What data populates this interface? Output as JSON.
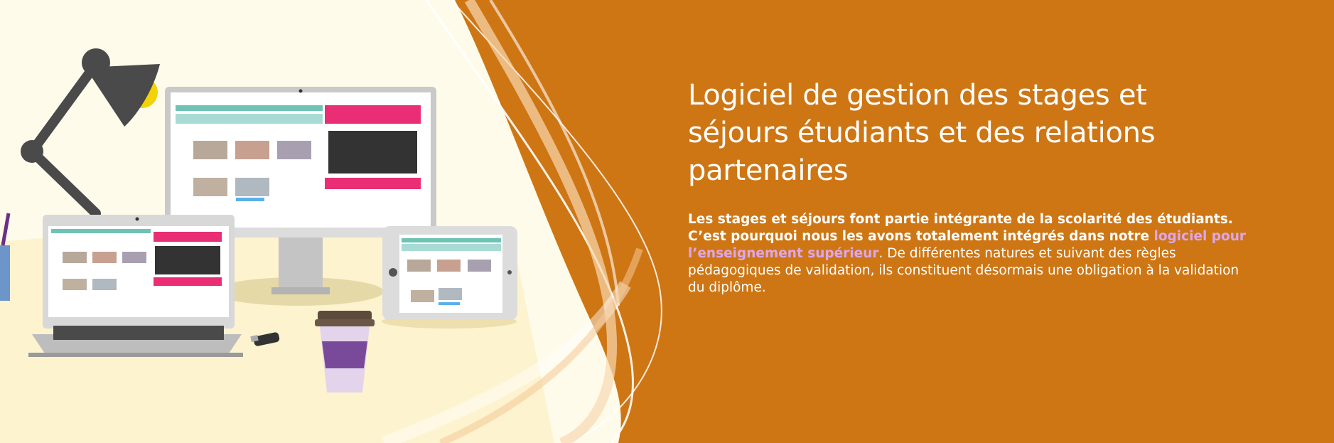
{
  "hero": {
    "title": "Logiciel de gestion des stages et séjours étudiants et des relations partenaires",
    "desc_bold": "Les stages et séjours font partie intégrante de la scolarité des étudiants. C’est pourquoi nous les avons totalement intégrés dans notre ",
    "desc_link": "logiciel pour l’enseignement supérieur",
    "desc_rest": ". De différentes natures et suivant des règles pédagogiques de validation, ils constituent désormais une obligation à la validation du diplôme."
  },
  "colors": {
    "background_orange": "#ce7614",
    "cream": "#fffbea",
    "link": "#dca6ee"
  },
  "icons": [
    "desk-lamp-icon",
    "desktop-monitor",
    "laptop",
    "tablet",
    "coffee-cup",
    "usb-key",
    "pencil-cup"
  ]
}
